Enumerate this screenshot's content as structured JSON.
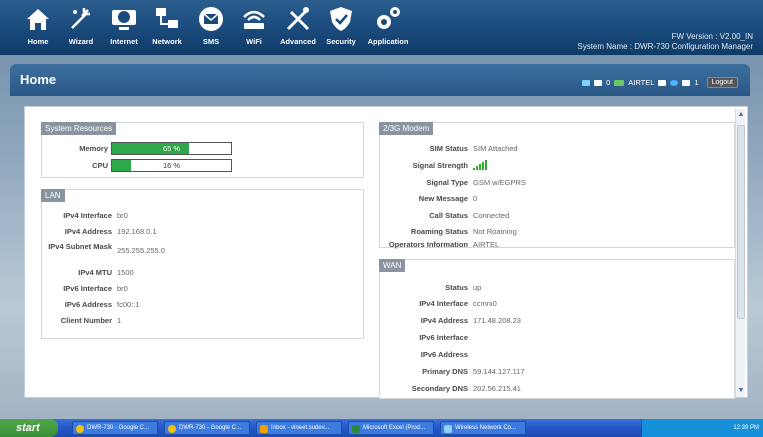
{
  "topnav": {
    "items": [
      {
        "label": "Home",
        "icon": "home-icon"
      },
      {
        "label": "Wizard",
        "icon": "wizard-icon"
      },
      {
        "label": "Internet",
        "icon": "internet-icon"
      },
      {
        "label": "Network",
        "icon": "network-icon"
      },
      {
        "label": "SMS",
        "icon": "sms-icon"
      },
      {
        "label": "WiFi",
        "icon": "wifi-icon"
      },
      {
        "label": "Advanced",
        "icon": "advanced-icon"
      },
      {
        "label": "Security",
        "icon": "security-icon"
      },
      {
        "label": "Application",
        "icon": "application-icon"
      }
    ],
    "fw_version": "FW Version : V2.00_IN",
    "system_name": "System Name : DWR-730 Configuration Manager"
  },
  "homebar": {
    "title": "Home",
    "message_count": "0",
    "operator": "AIRTEL",
    "count2": "1",
    "logout_label": "Logout"
  },
  "system_resources": {
    "title": "System Resources",
    "memory_label": "Memory",
    "memory_text": "65 %",
    "memory_value": 65,
    "cpu_label": "CPU",
    "cpu_text": "16 %",
    "cpu_value": 16
  },
  "lan": {
    "title": "LAN",
    "rows": [
      {
        "label": "IPv4 Interface",
        "value": "br0"
      },
      {
        "label": "IPv4 Address",
        "value": "192.168.0.1"
      },
      {
        "label": "IPv4 Subnet Mask",
        "value": "255.255.255.0"
      },
      {
        "label": "IPv4 MTU",
        "value": "1500"
      },
      {
        "label": "IPv6 Interface",
        "value": "br0"
      },
      {
        "label": "IPv6 Address",
        "value": "fc00::1"
      },
      {
        "label": "Client Number",
        "value": "1"
      }
    ]
  },
  "modem": {
    "title": "2/3G Modem",
    "rows": [
      {
        "label": "SIM Status",
        "value": "SIM Attached"
      },
      {
        "label": "Signal Strength",
        "value": ""
      },
      {
        "label": "Signal Type",
        "value": "GSM w/EGPRS"
      },
      {
        "label": "New Message",
        "value": "0"
      },
      {
        "label": "Call Status",
        "value": "Connected"
      },
      {
        "label": "Roaming Status",
        "value": "Not Roaming"
      },
      {
        "label": "Operators Information",
        "value": "AIRTEL"
      }
    ],
    "signal_bars": 5
  },
  "wan": {
    "title": "WAN",
    "rows": [
      {
        "label": "Status",
        "value": "up"
      },
      {
        "label": "IPv4 Interface",
        "value": "ccmni0"
      },
      {
        "label": "IPv4 Address",
        "value": "171.48.208.23"
      },
      {
        "label": "IPv6 Interface",
        "value": ""
      },
      {
        "label": "IPv6 Address",
        "value": ""
      },
      {
        "label": "Primary DNS",
        "value": "59.144.127.117"
      },
      {
        "label": "Secondary DNS",
        "value": "202.56.215.41"
      }
    ]
  },
  "taskbar": {
    "start_label": "start",
    "tasks": [
      {
        "label": "DWR-730 - Google C...",
        "icon": "chrome-icon"
      },
      {
        "label": "DWR-730 - Google C...",
        "icon": "chrome-icon"
      },
      {
        "label": "Inbox - vineet.sudev...",
        "icon": "outlook-icon"
      },
      {
        "label": "Microsoft Excel (Prod...",
        "icon": "excel-icon"
      },
      {
        "label": "Wireless Network Co...",
        "icon": "wireless-icon"
      }
    ],
    "clock": "12:39 PM"
  },
  "colors": {
    "nav_bg": "#1a4a7c",
    "bar_green": "#2ea84b",
    "signal_green": "#2eaa2e",
    "section_head": "#8a94a0"
  }
}
